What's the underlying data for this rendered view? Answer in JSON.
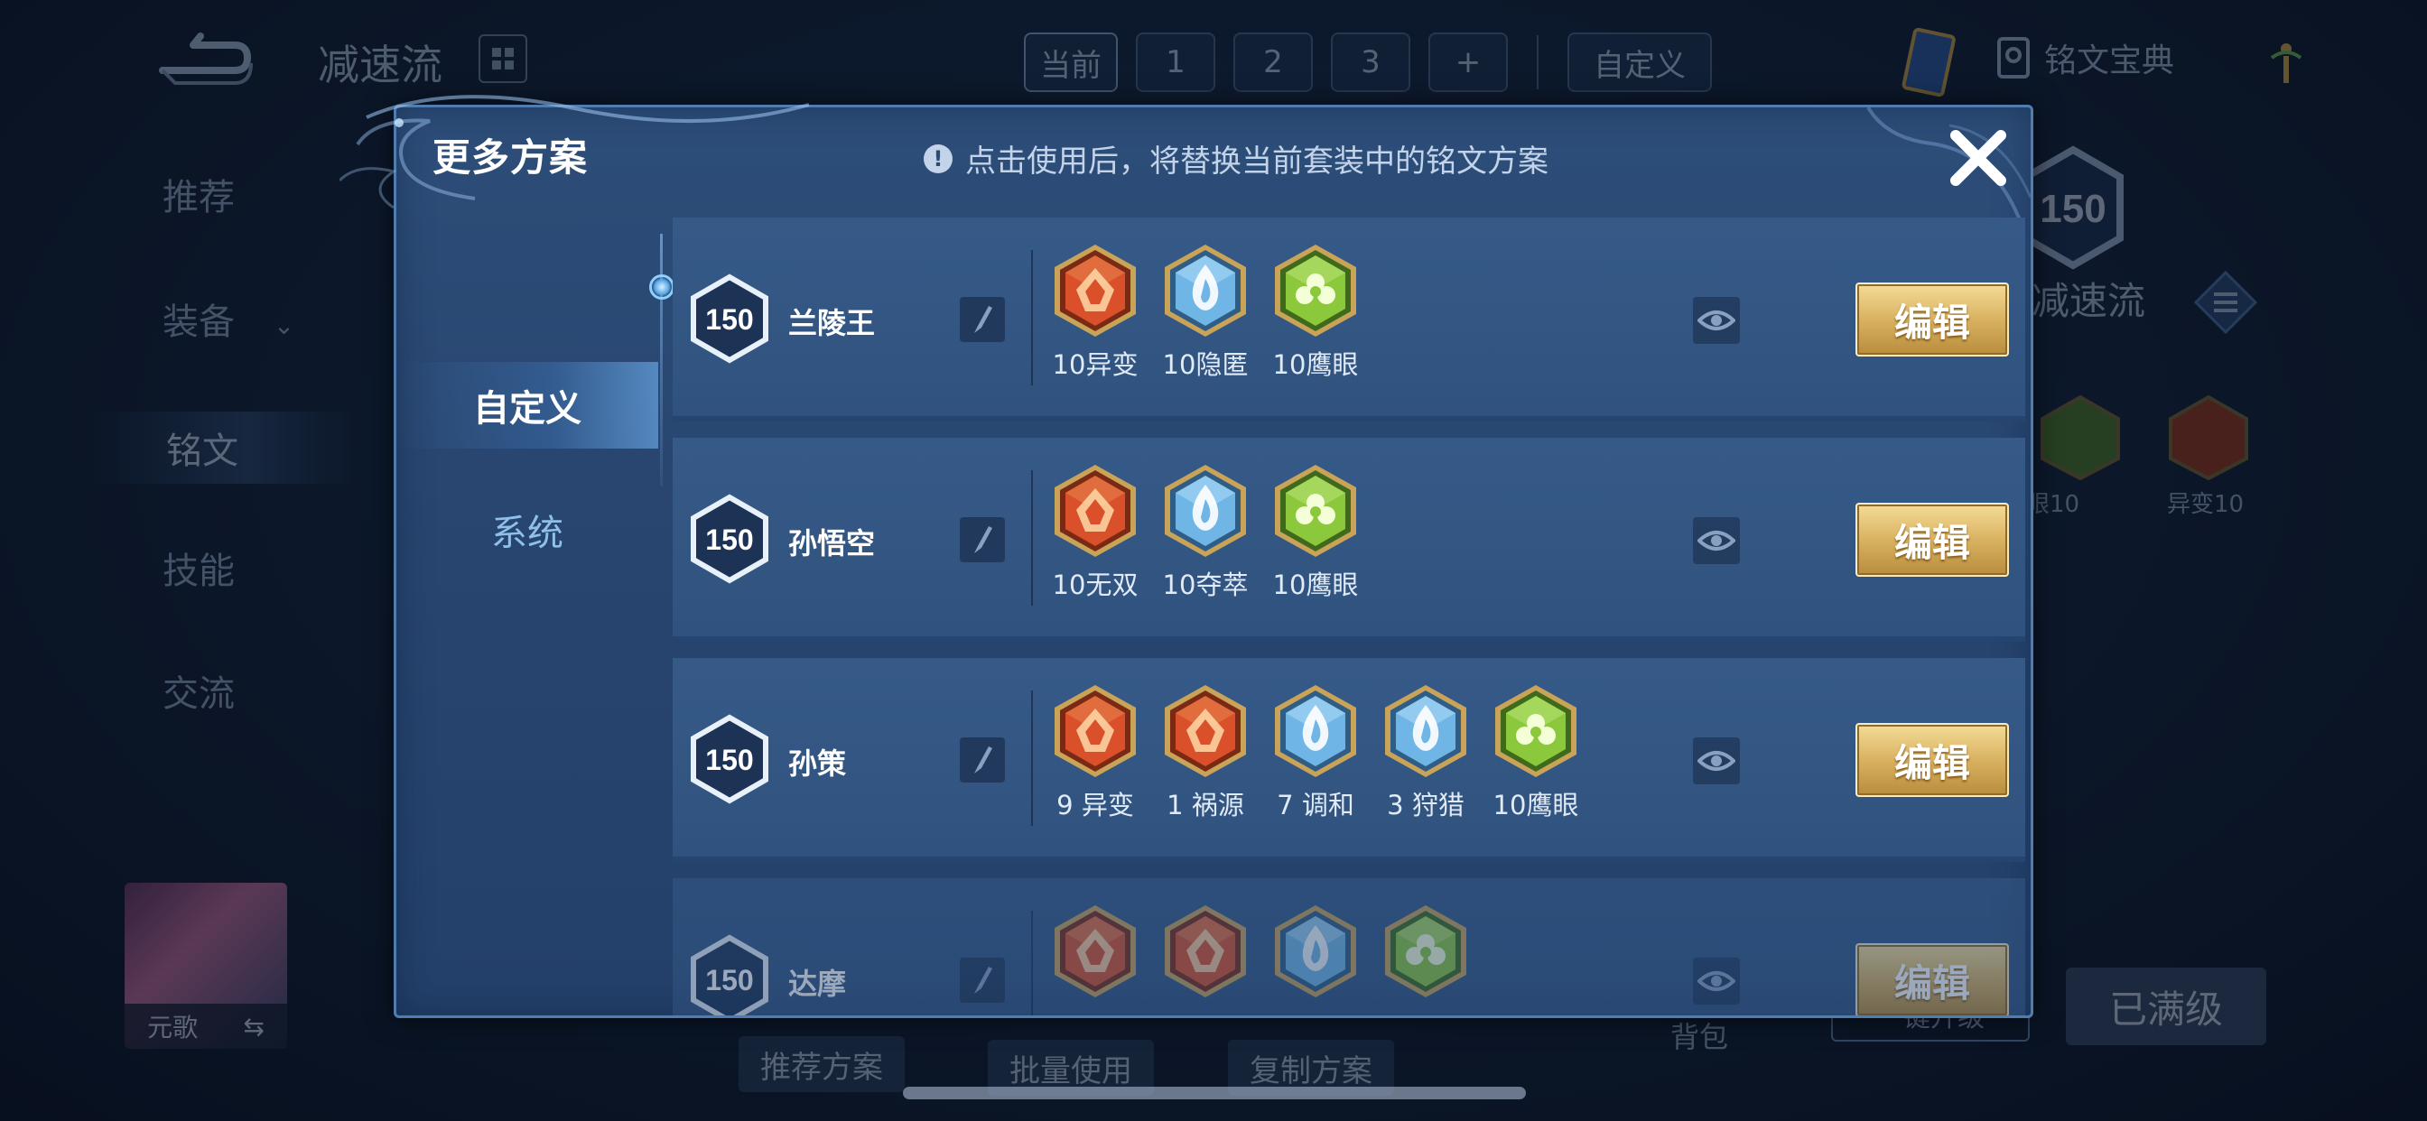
{
  "background": {
    "page_title": "减速流",
    "tabs": [
      {
        "label": "当前",
        "active": true
      },
      {
        "label": "1"
      },
      {
        "label": "2"
      },
      {
        "label": "3"
      },
      {
        "label": "+"
      }
    ],
    "custom_tab": "自定义",
    "rune_book": "铭文宝典",
    "sidebar": [
      "推荐",
      "装备",
      "铭文",
      "技能",
      "交流"
    ],
    "hero_name": "元歌",
    "level_badge": "150",
    "page_subtitle": "减速流",
    "bg_runes": [
      {
        "label": "眼10"
      },
      {
        "label": "异变10"
      }
    ],
    "bottom_buttons": [
      "推荐方案",
      "批量使用",
      "复制方案"
    ],
    "bag": "背包",
    "upgrade": "一键升级",
    "maxed": "已满级"
  },
  "modal": {
    "title": "更多方案",
    "notice": "点击使用后，将替换当前套装中的铭文方案",
    "side_tabs": [
      {
        "label": "自定义",
        "active": true
      },
      {
        "label": "系统",
        "active": false
      }
    ],
    "edit_label": "编辑",
    "plans": [
      {
        "level": "150",
        "hero": "兰陵王",
        "runes": [
          {
            "label": "10异变",
            "icon": "yibian-rune-icon",
            "color": "red"
          },
          {
            "label": "10隐匿",
            "icon": "yinni-rune-icon",
            "color": "blue"
          },
          {
            "label": "10鹰眼",
            "icon": "yingyan-rune-icon",
            "color": "green"
          }
        ]
      },
      {
        "level": "150",
        "hero": "孙悟空",
        "runes": [
          {
            "label": "10无双",
            "icon": "wushuang-rune-icon",
            "color": "red"
          },
          {
            "label": "10夺萃",
            "icon": "duocui-rune-icon",
            "color": "blue"
          },
          {
            "label": "10鹰眼",
            "icon": "yingyan-rune-icon",
            "color": "green"
          }
        ]
      },
      {
        "level": "150",
        "hero": "孙策",
        "runes": [
          {
            "label": "9 异变",
            "icon": "yibian-rune-icon",
            "color": "red"
          },
          {
            "label": "1 祸源",
            "icon": "huoyuan-rune-icon",
            "color": "red"
          },
          {
            "label": "7 调和",
            "icon": "tiaohe-rune-icon",
            "color": "blue"
          },
          {
            "label": "3 狩猎",
            "icon": "shoulie-rune-icon",
            "color": "blue"
          },
          {
            "label": "10鹰眼",
            "icon": "yingyan-rune-icon",
            "color": "green"
          }
        ]
      },
      {
        "level": "150",
        "hero": "达摩",
        "runes": [
          {
            "label": "",
            "icon": "huoyuan-rune-icon",
            "color": "red"
          },
          {
            "label": "",
            "icon": "yibian-rune-icon",
            "color": "red"
          },
          {
            "label": "",
            "icon": "yinni-rune-icon",
            "color": "blue"
          },
          {
            "label": "",
            "icon": "yingyan-rune-icon",
            "color": "green"
          }
        ]
      }
    ]
  },
  "colors": {
    "rune_red": "#d9502a",
    "rune_blue": "#6fb6e6",
    "rune_green": "#8cc83c",
    "edit_gold": "#d9b261",
    "modal_bg": "#2a4a74"
  }
}
